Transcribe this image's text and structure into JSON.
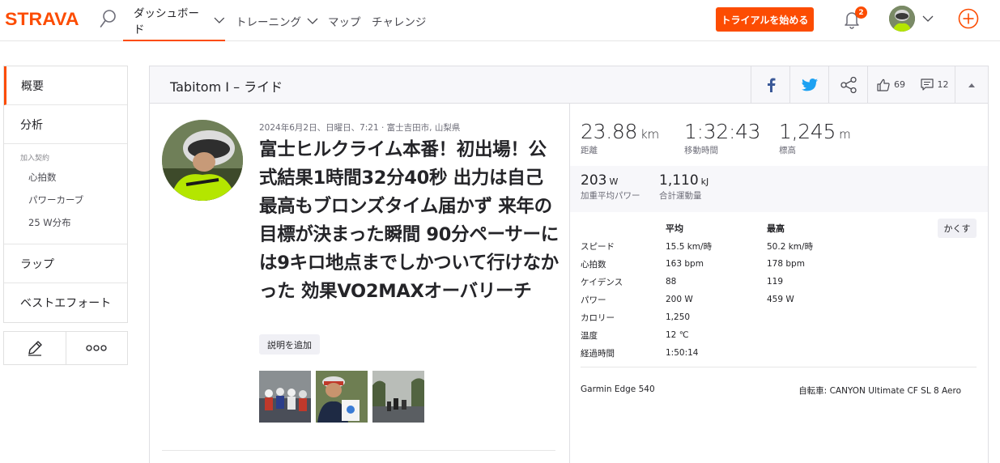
{
  "nav": {
    "logo": "STRAVA",
    "items": [
      {
        "label": "ダッシュボード"
      },
      {
        "label": "トレーニング"
      },
      {
        "label": "マップ"
      },
      {
        "label": "チャレンジ"
      }
    ],
    "trial_button": "トライアルを始める",
    "notification_count": "2",
    "accent_color": "#fc4c02"
  },
  "sidebar": {
    "items": [
      {
        "label": "概要"
      },
      {
        "label": "分析"
      }
    ],
    "subscription_head": "加入契約",
    "sub_items": [
      {
        "label": "心拍数"
      },
      {
        "label": "パワーカーブ"
      },
      {
        "label": "25 W分布"
      }
    ],
    "items_after": [
      {
        "label": "ラップ"
      },
      {
        "label": "ベストエフォート"
      }
    ]
  },
  "activity": {
    "header_title": "Tabitom I – ライド",
    "kudos_count": "69",
    "comment_count": "12",
    "meta": "2024年6月2日、日曜日、7:21 · 富士吉田市, 山梨県",
    "title": "富士ヒルクライム本番！初出場！公式結果1時間32分40秒 出力は自己最高もブロンズタイム届かず 来年の目標が決まった瞬間 90分ペーサーには9キロ地点までしかついて行けなかった 効果VO2MAXオーバリーチ",
    "add_description": "説明を追加"
  },
  "stats": {
    "primary": [
      {
        "value": "23.88",
        "unit": "km",
        "label": "距離"
      },
      {
        "value": "1:32:43",
        "unit": "",
        "label": "移動時間"
      },
      {
        "value": "1,245",
        "unit": "m",
        "label": "標高"
      }
    ],
    "secondary": [
      {
        "value": "203",
        "unit": "W",
        "label": "加重平均パワー"
      },
      {
        "value": "1,110",
        "unit": "kJ",
        "label": "合計運動量"
      }
    ],
    "table_headers": {
      "avg": "平均",
      "max": "最高"
    },
    "hide_button": "かくす",
    "rows": [
      {
        "label": "スピード",
        "avg": "15.5 km/時",
        "max": "50.2 km/時"
      },
      {
        "label": "心拍数",
        "avg": "163 bpm",
        "max": "178 bpm"
      },
      {
        "label": "ケイデンス",
        "avg": "88",
        "max": "119"
      },
      {
        "label": "パワー",
        "avg": "200 W",
        "max": "459 W"
      },
      {
        "label": "カロリー",
        "avg": "1,250",
        "max": ""
      },
      {
        "label": "温度",
        "avg": "12 ℃",
        "max": ""
      },
      {
        "label": "経過時間",
        "avg": "1:50:14",
        "max": ""
      }
    ],
    "device": "Garmin Edge 540",
    "bike": "自転車: CANYON Ultimate CF SL 8 Aero"
  }
}
